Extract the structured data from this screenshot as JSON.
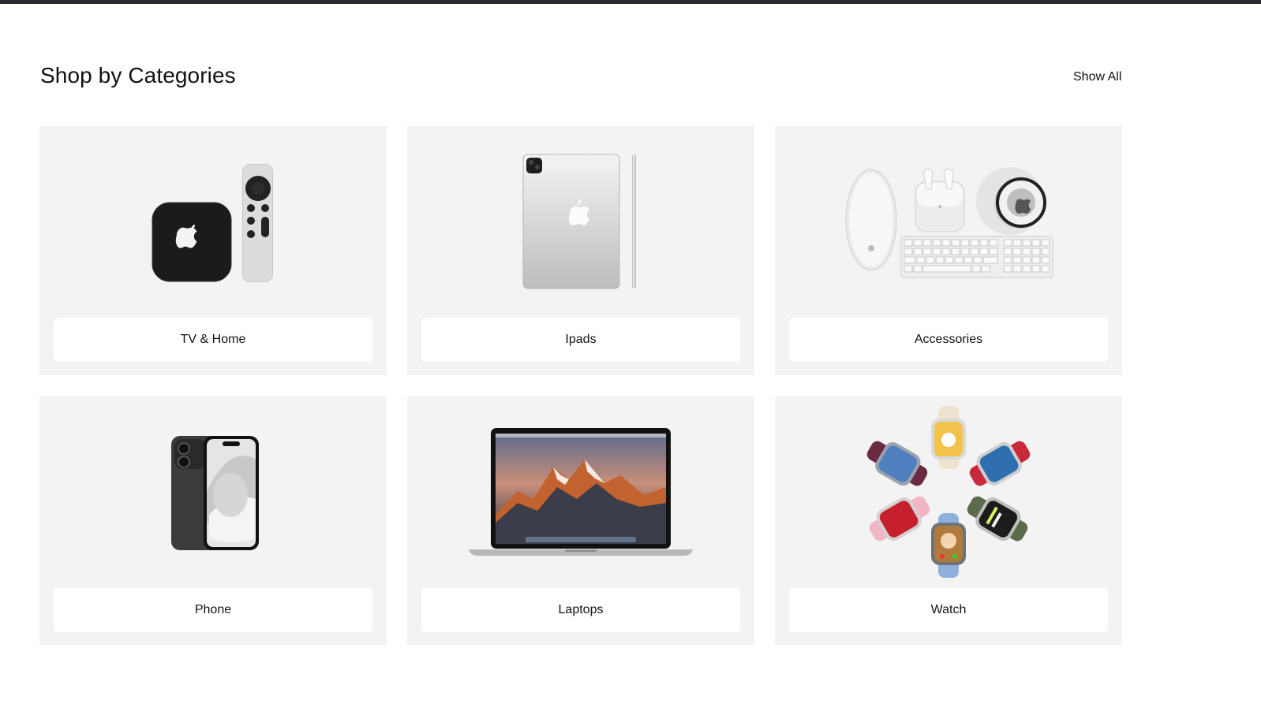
{
  "section": {
    "title": "Shop by Categories",
    "show_all_label": "Show All"
  },
  "categories": [
    {
      "label": "TV & Home",
      "icon": "apple-tv-image"
    },
    {
      "label": "Ipads",
      "icon": "ipad-image"
    },
    {
      "label": "Accessories",
      "icon": "accessories-image"
    },
    {
      "label": "Phone",
      "icon": "iphone-image"
    },
    {
      "label": "Laptops",
      "icon": "macbook-image"
    },
    {
      "label": "Watch",
      "icon": "apple-watch-image"
    }
  ],
  "colors": {
    "card_background": "#f3f3f3",
    "label_background": "#ffffff",
    "top_bar": "#2a2a2e",
    "text": "#111111"
  }
}
